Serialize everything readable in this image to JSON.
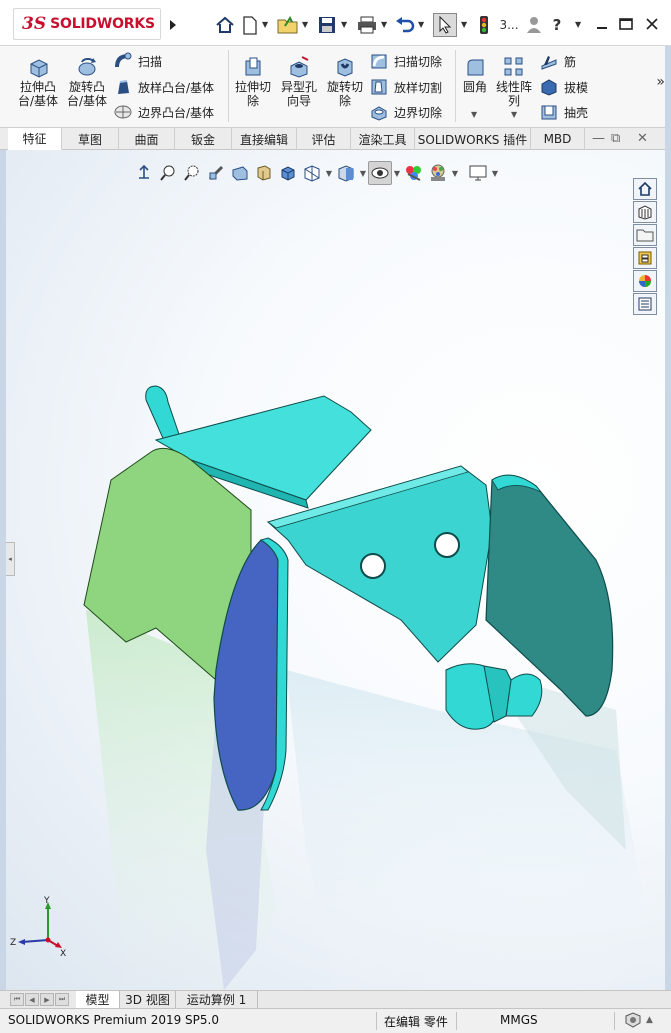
{
  "app": {
    "logo_mark": "3S",
    "logo_text": "SOLIDWORKS",
    "window_number_badge": "3..."
  },
  "ribbon": {
    "big_buttons": [
      {
        "label": "拉伸凸\n台/基体",
        "icon": "extrude-boss-icon"
      },
      {
        "label": "旋转凸\n台/基体",
        "icon": "revolve-boss-icon"
      },
      {
        "label": "拉伸切\n除",
        "icon": "extrude-cut-icon"
      },
      {
        "label": "异型孔\n向导",
        "icon": "hole-wizard-icon"
      },
      {
        "label": "旋转切\n除",
        "icon": "revolve-cut-icon"
      },
      {
        "label": "圆角",
        "icon": "fillet-icon"
      },
      {
        "label": "线性阵\n列",
        "icon": "linear-pattern-icon"
      }
    ],
    "small_buttons": [
      {
        "label": "扫描",
        "icon": "sweep-icon"
      },
      {
        "label": "放样凸台/基体",
        "icon": "loft-icon"
      },
      {
        "label": "边界凸台/基体",
        "icon": "boundary-boss-icon"
      },
      {
        "label": "扫描切除",
        "icon": "swept-cut-icon"
      },
      {
        "label": "放样切割",
        "icon": "lofted-cut-icon"
      },
      {
        "label": "边界切除",
        "icon": "boundary-cut-icon"
      },
      {
        "label": "筋",
        "icon": "rib-icon"
      },
      {
        "label": "拔模",
        "icon": "draft-icon"
      },
      {
        "label": "抽壳",
        "icon": "shell-icon"
      }
    ],
    "more_symbol": "»"
  },
  "tabs": [
    "特征",
    "草图",
    "曲面",
    "钣金",
    "直接编辑",
    "评估",
    "渲染工具",
    "SOLIDWORKS 插件",
    "MBD"
  ],
  "active_tab": "特征",
  "bottom_tabs": [
    "模型",
    "3D 视图",
    "运动算例 1"
  ],
  "active_bottom_tab": "模型",
  "status": {
    "product": "SOLIDWORKS Premium 2019 SP5.0",
    "mode": "在编辑 零件",
    "units": "MMGS"
  },
  "triad": {
    "x": "X",
    "y": "Y",
    "z": "Z"
  },
  "colors": {
    "accent_red": "#c8102e",
    "part_cyan": "#32d8d4",
    "part_green": "#8fd47e",
    "part_blue": "#4665c2",
    "part_teal": "#2f8a86"
  }
}
